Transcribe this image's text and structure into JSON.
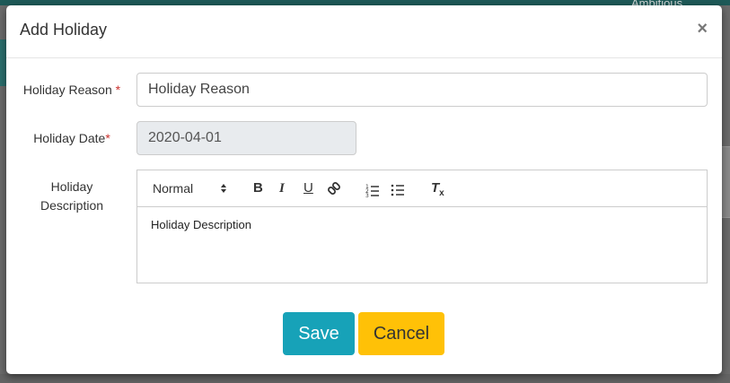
{
  "background": {
    "user_text": "Ambitious"
  },
  "modal": {
    "title": "Add Holiday",
    "close_symbol": "×"
  },
  "form": {
    "reason_label": "Holiday Reason",
    "reason_required": "*",
    "reason_value": "Holiday Reason",
    "date_label": "Holiday Date",
    "date_required": "*",
    "date_value": "2020-04-01",
    "description_label_line1": "Holiday",
    "description_label_line2": "Description"
  },
  "editor": {
    "format_select": "Normal",
    "toolbar_icons": [
      "bold-icon",
      "italic-icon",
      "underline-icon",
      "link-icon",
      "ordered-list-icon",
      "bullet-list-icon",
      "clear-format-icon"
    ],
    "bold_glyph": "B",
    "italic_glyph": "I",
    "underline_glyph": "U",
    "clean_glyph": "T",
    "clean_sub": "x",
    "content": "Holiday Description"
  },
  "buttons": {
    "save_label": "Save",
    "cancel_label": "Cancel"
  },
  "colors": {
    "save": "#17a2b8",
    "cancel": "#ffc107",
    "required": "#c9302c",
    "topbar": "#1e5a58"
  }
}
